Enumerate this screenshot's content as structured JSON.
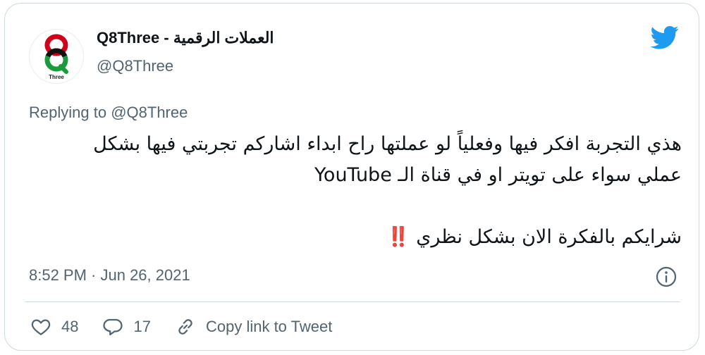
{
  "author": {
    "name": "Q8Three - العملات الرقمية",
    "handle": "@Q8Three",
    "avatar_text": "Three"
  },
  "replying": {
    "prefix": "Replying to",
    "mention": "@Q8Three"
  },
  "tweet": {
    "line1": "هذي التجربة افكر فيها وفعلياً لو عملتها راح ابداء اشاركم تجربتي فيها بشكل",
    "line2": "عملي سواء على تويتر او في قناة الـ YouTube",
    "line3": "شرايكم بالفكرة الان بشكل نظري",
    "emoji": "‼️"
  },
  "meta": {
    "timestamp": "8:52 PM · Jun 26, 2021"
  },
  "actions": {
    "likes": "48",
    "replies": "17",
    "copy_link": "Copy link to Tweet"
  },
  "colors": {
    "brand": "#1d9bf0",
    "muted": "#536471",
    "border": "#cfd9de"
  },
  "icons": [
    "twitter-bird-icon",
    "info-icon",
    "heart-icon",
    "reply-bubble-icon",
    "link-icon"
  ]
}
